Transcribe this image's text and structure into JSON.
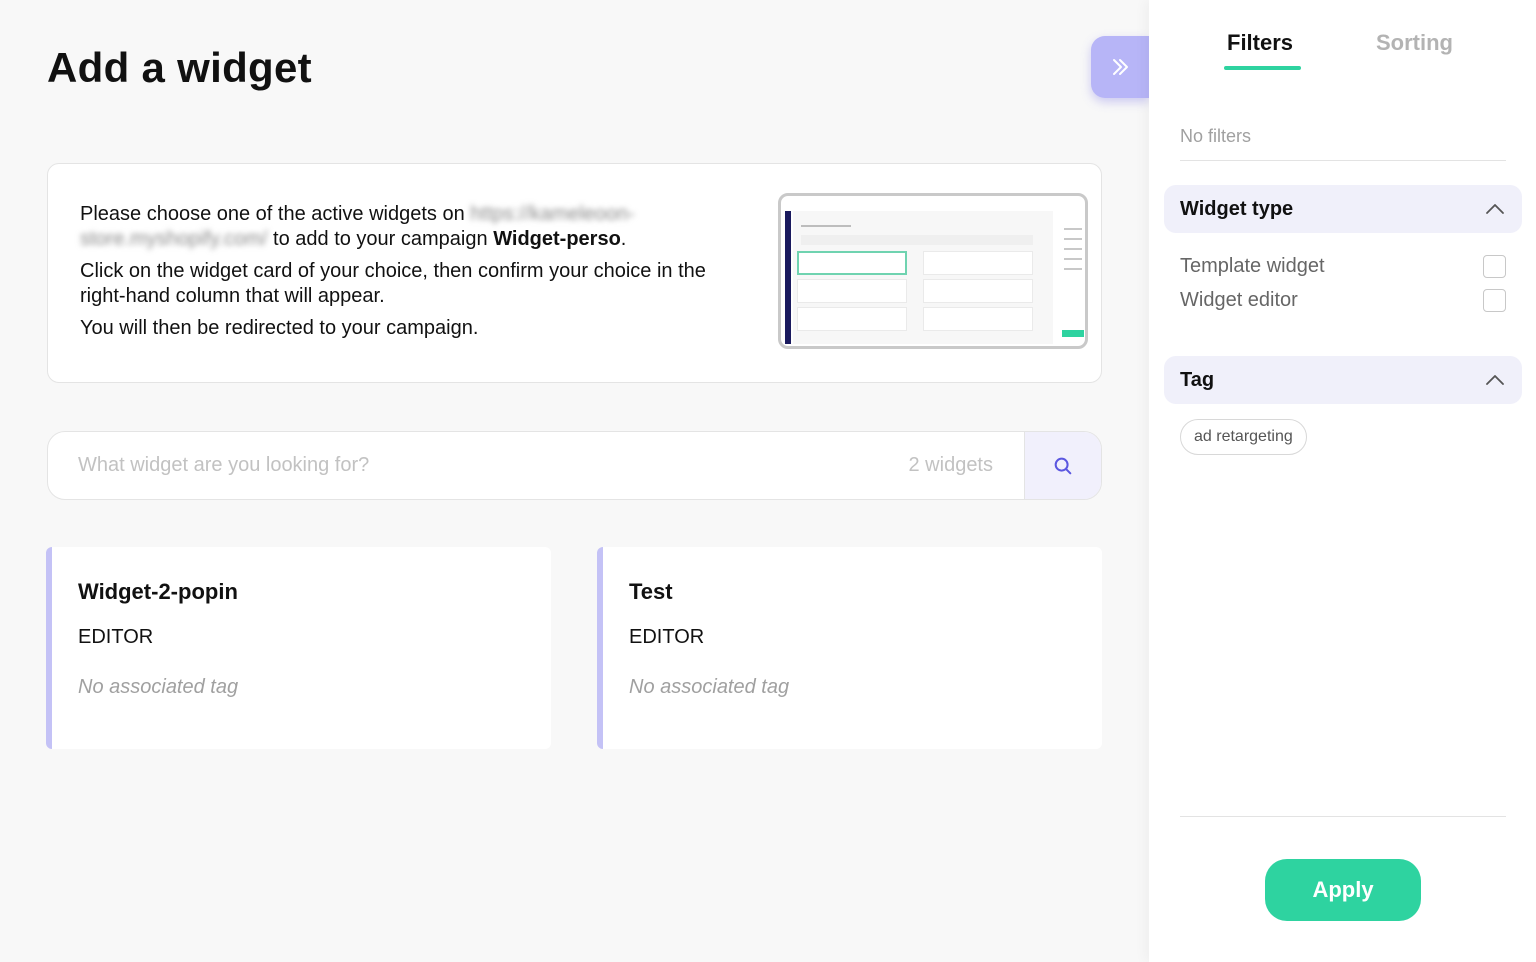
{
  "page": {
    "title": "Add a widget"
  },
  "info": {
    "line1_prefix": "Please choose one of the active widgets on",
    "url_blurred": "https://kameleoon-store.myshopify.com/",
    "line1_middle": "to add to your campaign",
    "campaign_name": "Widget-perso",
    "line1_suffix": ".",
    "line2": "Click on the widget card of your choice, then confirm your choice in the right-hand column that will appear.",
    "line3": "You will then be redirected to your campaign."
  },
  "search": {
    "placeholder": "What widget are you looking for?",
    "count": "2 widgets"
  },
  "widgets": [
    {
      "name": "Widget-2-popin",
      "type": "EDITOR",
      "tag": "No associated tag"
    },
    {
      "name": "Test",
      "type": "EDITOR",
      "tag": "No associated tag"
    }
  ],
  "panel": {
    "tabs": [
      {
        "label": "Filters",
        "active": true
      },
      {
        "label": "Sorting",
        "active": false
      }
    ],
    "no_filters": "No filters",
    "widget_type": {
      "title": "Widget type",
      "options": [
        "Template widget",
        "Widget editor"
      ]
    },
    "tag": {
      "title": "Tag",
      "chips": [
        "ad retargeting"
      ]
    },
    "apply_label": "Apply"
  },
  "colors": {
    "accent": "#2ed3a0",
    "purple": "#b7b5f7",
    "card_border": "#c4c2f6",
    "section_bg": "#f0f0fa"
  },
  "icons": {
    "collapse": "double-chevron-right-icon",
    "search": "search-icon",
    "section_toggle": "chevron-up-icon"
  }
}
